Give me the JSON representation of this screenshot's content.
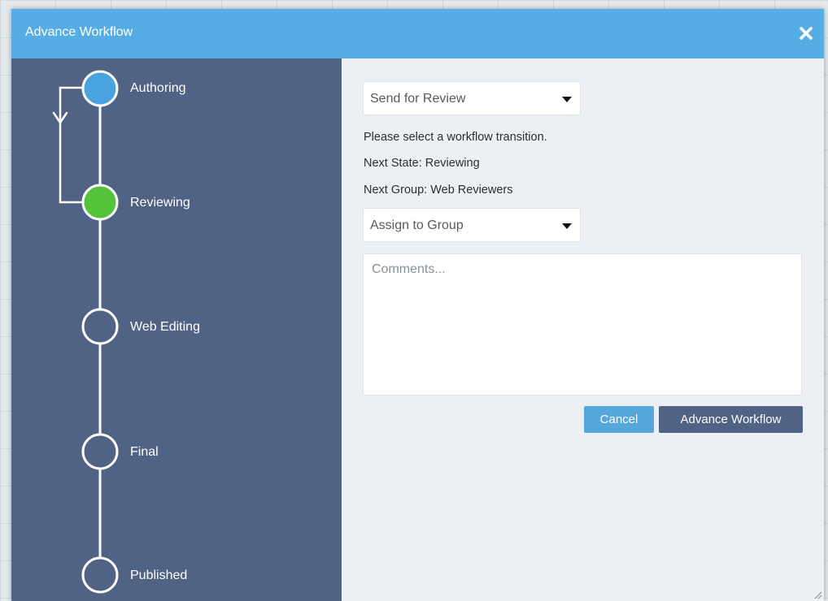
{
  "modal": {
    "title": "Advance Workflow",
    "close_glyph": "✖"
  },
  "workflow": {
    "states": [
      {
        "label": "Authoring",
        "status": "current",
        "color": "#4aa3df"
      },
      {
        "label": "Reviewing",
        "status": "next",
        "color": "#54c23a"
      },
      {
        "label": "Web Editing",
        "status": "pending"
      },
      {
        "label": "Final",
        "status": "pending"
      },
      {
        "label": "Published",
        "status": "pending"
      }
    ]
  },
  "form": {
    "transition_select": {
      "value": "Send for Review"
    },
    "message": "Please select a workflow transition.",
    "next_state": "Next State: Reviewing",
    "next_group": "Next Group: Web Reviewers",
    "group_select": {
      "value": "Assign to Group"
    },
    "comments_placeholder": "Comments...",
    "cancel_label": "Cancel",
    "advance_label": "Advance Workflow"
  },
  "colors": {
    "header": "#55ade3",
    "left_panel": "#506384",
    "right_panel": "#ecf0f4",
    "cancel_button": "#57a7dc",
    "advance_button": "#506384"
  },
  "icons": {
    "close": "close-icon",
    "caret": "caret-down-icon",
    "resize": "resize-grip-icon"
  }
}
